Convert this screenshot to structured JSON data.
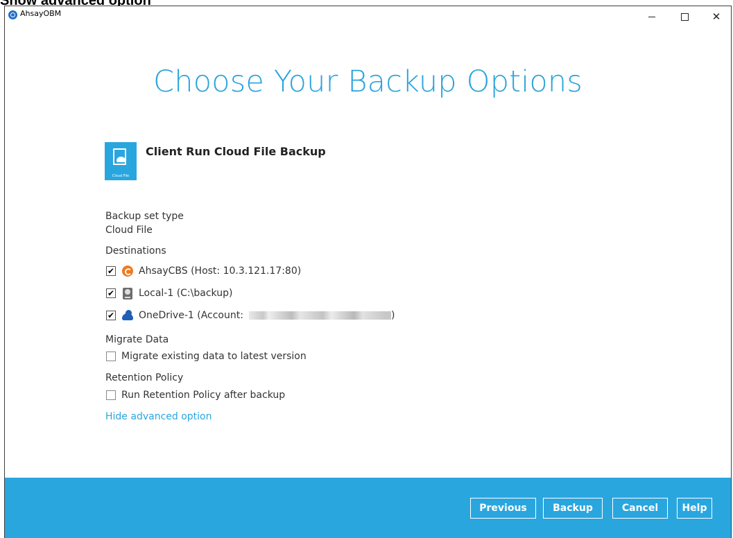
{
  "doc_heading": "Show advanced option",
  "window": {
    "app_title": "AhsayOBM",
    "minimize_icon": "minimize-icon",
    "maximize_icon": "maximize-icon",
    "close_icon": "close-icon"
  },
  "page_title": "Choose Your Backup Options",
  "backup_set": {
    "name": "Client Run Cloud File Backup",
    "icon": "cloud-file-icon",
    "icon_caption": "Cloud File",
    "icon_color": "#2aa6df"
  },
  "backup_set_type": {
    "label": "Backup set type",
    "value": "Cloud File"
  },
  "destinations": {
    "label": "Destinations",
    "items": [
      {
        "label": "AhsayCBS (Host: 10.3.121.17:80)",
        "icon": "ahsaycbs-icon",
        "checked": true
      },
      {
        "label": "Local-1 (C:\\backup)",
        "icon": "local-disk-icon",
        "checked": true
      },
      {
        "label_prefix": "OneDrive-1 (Account:",
        "label_suffix": ")",
        "icon": "onedrive-icon",
        "checked": true
      }
    ]
  },
  "migrate_data": {
    "label": "Migrate Data",
    "option": "Migrate existing data to latest version",
    "checked": false
  },
  "retention_policy": {
    "label": "Retention Policy",
    "option": "Run Retention Policy after backup",
    "checked": false
  },
  "advanced_toggle": "Hide advanced option",
  "footer": {
    "previous": "Previous",
    "backup": "Backup",
    "cancel": "Cancel",
    "help": "Help"
  },
  "colors": {
    "accent": "#29a3dc",
    "footer": "#2aa6df",
    "cbs_orange": "#f07a1e",
    "onedrive_blue": "#1f5fb8"
  }
}
